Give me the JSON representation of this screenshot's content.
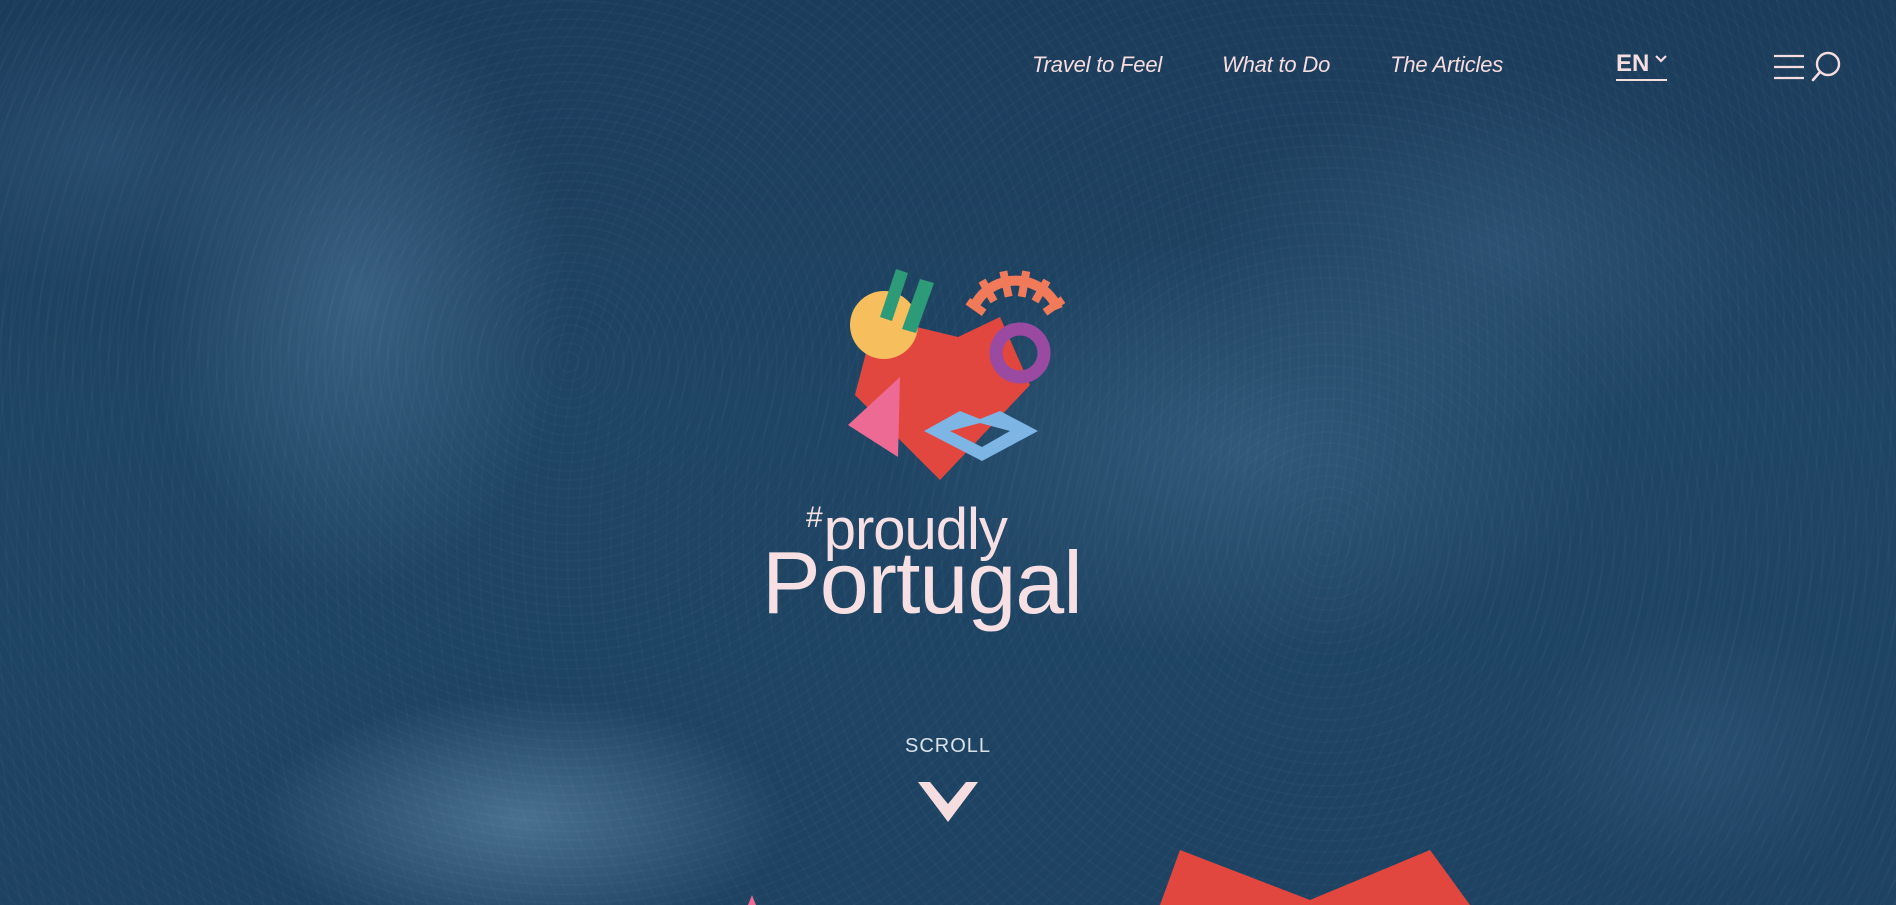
{
  "nav": {
    "items": [
      {
        "label": "Travel to Feel"
      },
      {
        "label": "What to Do"
      },
      {
        "label": "The Articles"
      }
    ]
  },
  "language": {
    "current": "EN"
  },
  "icons": {
    "menu": "hamburger-menu-icon",
    "search": "search-icon",
    "language_dropdown": "chevron-down-icon",
    "scroll": "chevron-down-icon"
  },
  "logo": {
    "hash": "#",
    "tagline": "proudly",
    "name": "Portugal"
  },
  "scroll": {
    "label": "SCROLL"
  },
  "colors": {
    "background": "#1b3b5a",
    "text_light": "#f6dde0",
    "heart_red": "#e2473f",
    "yellow": "#f7be5e",
    "green": "#2e9b78",
    "coral": "#f07a5a",
    "purple": "#9b4aa1",
    "pink": "#ec6a93",
    "light_blue": "#7db5e5"
  }
}
